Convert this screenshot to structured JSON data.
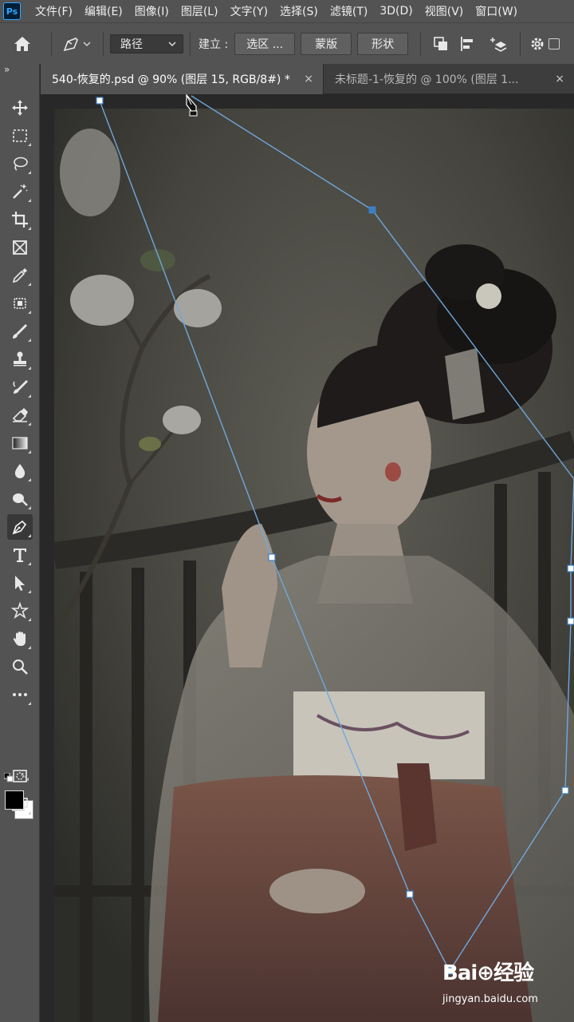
{
  "app": {
    "logo": "Ps"
  },
  "menu": [
    "文件(F)",
    "编辑(E)",
    "图像(I)",
    "图层(L)",
    "文字(Y)",
    "选择(S)",
    "滤镜(T)",
    "3D(D)",
    "视图(V)",
    "窗口(W)"
  ],
  "options": {
    "mode_value": "路径",
    "make_label": "建立 :",
    "selection_btn": "选区 ...",
    "mask_btn": "蒙版",
    "shape_btn": "形状"
  },
  "tabs": [
    {
      "label": "540-恢复的.psd @ 90% (图层 15, RGB/8#) *",
      "close": "×"
    },
    {
      "label": "未标题-1-恢复的 @ 100% (图层 1...",
      "close": "×"
    }
  ],
  "toolbar": {
    "collapse": "»",
    "tools": [
      "move-tool",
      "marquee-tool",
      "lasso-tool",
      "magic-wand-tool",
      "crop-tool",
      "frame-tool",
      "eyedropper-tool",
      "patch-tool",
      "brush-tool",
      "stamp-tool",
      "history-brush-tool",
      "eraser-tool",
      "gradient-tool",
      "blur-tool",
      "dodge-tool",
      "pen-tool",
      "type-tool",
      "path-selection-tool",
      "custom-shape-tool",
      "hand-tool",
      "zoom-tool",
      "more-tools"
    ],
    "active_tool": "pen-tool",
    "foreground": "#000000",
    "background": "#ffffff"
  },
  "watermark": {
    "logo": "Bai⊕经验",
    "url": "jingyan.baidu.com"
  },
  "colors": {
    "path": "#6fa8dc",
    "ui_panel": "#535353",
    "tab_bar": "#3d3d3d"
  }
}
